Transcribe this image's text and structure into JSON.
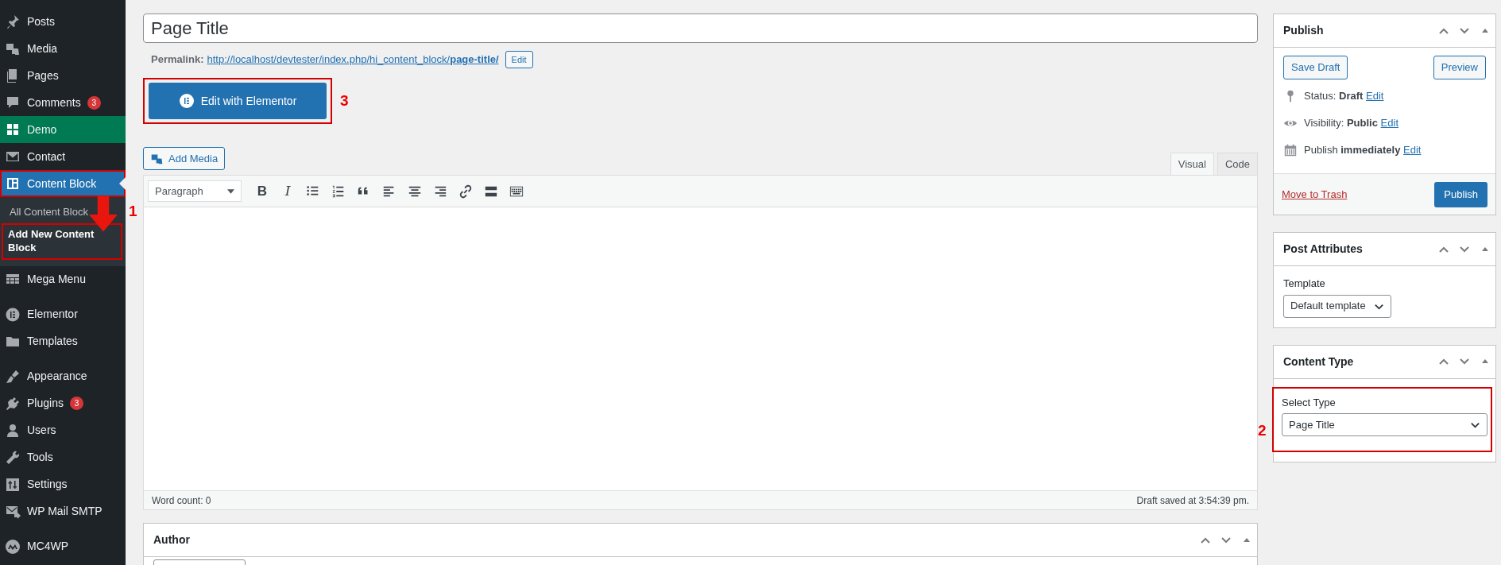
{
  "sidebar": {
    "groups": [
      {
        "items": [
          {
            "label": "Posts",
            "selected": false
          },
          {
            "label": "Media",
            "selected": false
          },
          {
            "label": "Pages",
            "selected": false
          },
          {
            "label": "Comments",
            "badge": "3",
            "selected": false
          },
          {
            "label": "Demo",
            "color": "#007a52",
            "selected": false
          },
          {
            "label": "Contact",
            "selected": false
          },
          {
            "label": "Content Block",
            "selected": true,
            "outlined": true,
            "children": [
              {
                "label": "All Content Block",
                "selected": false,
                "outlined": false
              },
              {
                "label": "Add New Content Block",
                "selected": true,
                "outlined": true
              }
            ]
          },
          {
            "label": "Mega Menu",
            "selected": false
          }
        ]
      },
      {
        "items": [
          {
            "label": "Elementor",
            "selected": false
          },
          {
            "label": "Templates",
            "selected": false
          }
        ]
      },
      {
        "items": [
          {
            "label": "Appearance",
            "selected": false
          },
          {
            "label": "Plugins",
            "badge": "3",
            "selected": false
          },
          {
            "label": "Users",
            "selected": false
          },
          {
            "label": "Tools",
            "selected": false
          },
          {
            "label": "Settings",
            "selected": false
          },
          {
            "label": "WP Mail SMTP",
            "selected": false
          }
        ]
      },
      {
        "items": [
          {
            "label": "MC4WP",
            "selected": false
          }
        ]
      }
    ],
    "annotation": {
      "label": "1"
    }
  },
  "editor": {
    "title": "Page Title",
    "permalink": {
      "label": "Permalink:",
      "url": "http://localhost/devtester/index.php/hi_content_block/**page-title/**",
      "edit_button": "Edit"
    },
    "elementor_button": {
      "label": "Edit with Elementor",
      "outlined": true,
      "annotation": "3"
    },
    "add_media": "Add Media",
    "tabs": [
      {
        "label": "Visual",
        "selected": true
      },
      {
        "label": "Code",
        "selected": false
      }
    ],
    "format_select": "Paragraph",
    "toolbar": [
      {
        "kind": "bold",
        "label": "B"
      },
      {
        "kind": "italic",
        "label": "I"
      },
      {
        "kind": "bullet-list"
      },
      {
        "kind": "numbered-list"
      },
      {
        "kind": "quote"
      },
      {
        "kind": "align-left"
      },
      {
        "kind": "align-center"
      },
      {
        "kind": "align-right"
      },
      {
        "kind": "link"
      },
      {
        "kind": "read-more"
      },
      {
        "kind": "toolbar-toggle"
      }
    ],
    "word_count": "Word count: 0",
    "draft_saved": "Draft saved at 3:54:39 pm."
  },
  "author_box": {
    "title": "Author"
  },
  "publish_box": {
    "title": "Publish",
    "save_draft": "Save Draft",
    "preview": "Preview",
    "rows": [
      {
        "kind": "status",
        "text": "Status: **Draft**",
        "link": "Edit"
      },
      {
        "kind": "visibility",
        "text": "Visibility: **Public**",
        "link": "Edit"
      },
      {
        "kind": "schedule",
        "text": "Publish **immediately**",
        "link": "Edit"
      }
    ],
    "trash": "Move to Trash",
    "publish": "Publish"
  },
  "post_attributes": {
    "title": "Post Attributes",
    "field_label": "Template",
    "value": "Default template"
  },
  "content_type": {
    "title": "Content Type",
    "field_label": "Select Type",
    "value": "Page Title",
    "outlined": true,
    "annotation": "2"
  }
}
